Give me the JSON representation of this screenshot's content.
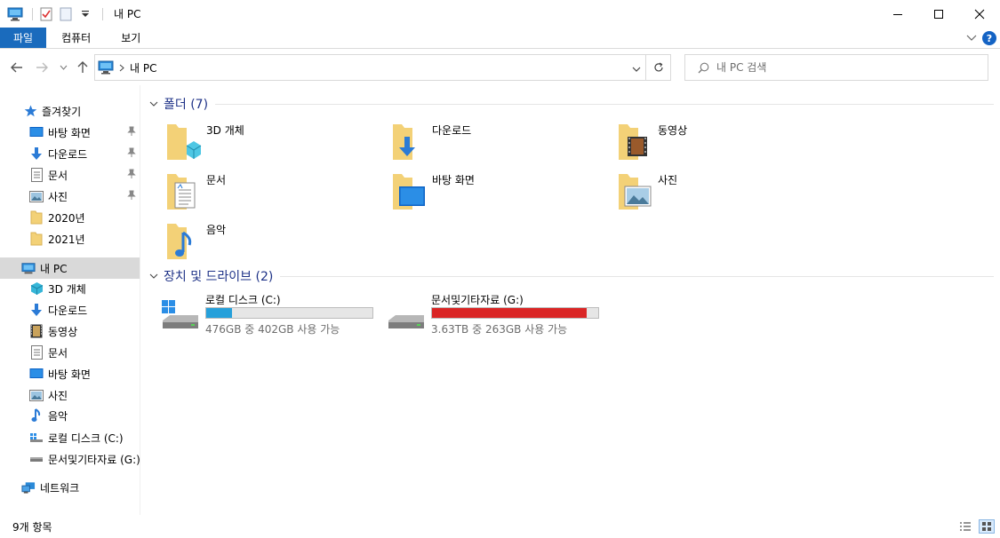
{
  "window": {
    "title": "내 PC"
  },
  "ribbon": {
    "tabs": [
      "파일",
      "컴퓨터",
      "보기"
    ]
  },
  "address": {
    "location": "내 PC"
  },
  "search": {
    "placeholder": "내 PC 검색"
  },
  "sidebar": {
    "quick_access": "즐겨찾기",
    "pinned": [
      {
        "label": "바탕 화면",
        "icon": "desktop-icon",
        "pinned": true
      },
      {
        "label": "다운로드",
        "icon": "download-icon",
        "pinned": true
      },
      {
        "label": "문서",
        "icon": "document-icon",
        "pinned": true
      },
      {
        "label": "사진",
        "icon": "picture-icon",
        "pinned": true
      },
      {
        "label": "2020년",
        "icon": "folder-icon",
        "pinned": false
      },
      {
        "label": "2021년",
        "icon": "folder-icon",
        "pinned": false
      }
    ],
    "this_pc": "내 PC",
    "pc_items": [
      {
        "label": "3D 개체",
        "icon": "3d-objects-icon"
      },
      {
        "label": "다운로드",
        "icon": "download-icon"
      },
      {
        "label": "동영상",
        "icon": "video-icon"
      },
      {
        "label": "문서",
        "icon": "document-icon"
      },
      {
        "label": "바탕 화면",
        "icon": "desktop-icon"
      },
      {
        "label": "사진",
        "icon": "picture-icon"
      },
      {
        "label": "음악",
        "icon": "music-icon"
      },
      {
        "label": "로컬 디스크 (C:)",
        "icon": "windows-drive-icon"
      },
      {
        "label": "문서및기타자료 (G:)",
        "icon": "drive-icon"
      }
    ],
    "network": "네트워크"
  },
  "main": {
    "folders_group": "폴더 (7)",
    "folders": [
      {
        "label": "3D 개체",
        "icon": "3d-objects-folder-icon"
      },
      {
        "label": "다운로드",
        "icon": "downloads-folder-icon"
      },
      {
        "label": "동영상",
        "icon": "videos-folder-icon"
      },
      {
        "label": "문서",
        "icon": "documents-folder-icon"
      },
      {
        "label": "바탕 화면",
        "icon": "desktop-folder-icon"
      },
      {
        "label": "사진",
        "icon": "pictures-folder-icon"
      },
      {
        "label": "음악",
        "icon": "music-folder-icon"
      }
    ],
    "drives_group": "장치 및 드라이브 (2)",
    "drives": [
      {
        "label": "로컬 디스크 (C:)",
        "free_text": "476GB 중 402GB 사용 가능",
        "used_fraction": 0.155,
        "bar_color": "#26a0da",
        "icon": "windows-drive-icon"
      },
      {
        "label": "문서및기타자료 (G:)",
        "free_text": "3.63TB 중 263GB 사용 가능",
        "used_fraction": 0.929,
        "bar_color": "#da2626",
        "icon": "drive-icon"
      }
    ]
  },
  "status": {
    "item_count": "9개 항목"
  },
  "colors": {
    "accent": "#1a6bbd",
    "group_title": "#1e3287",
    "selected": "#d9d9d9"
  }
}
